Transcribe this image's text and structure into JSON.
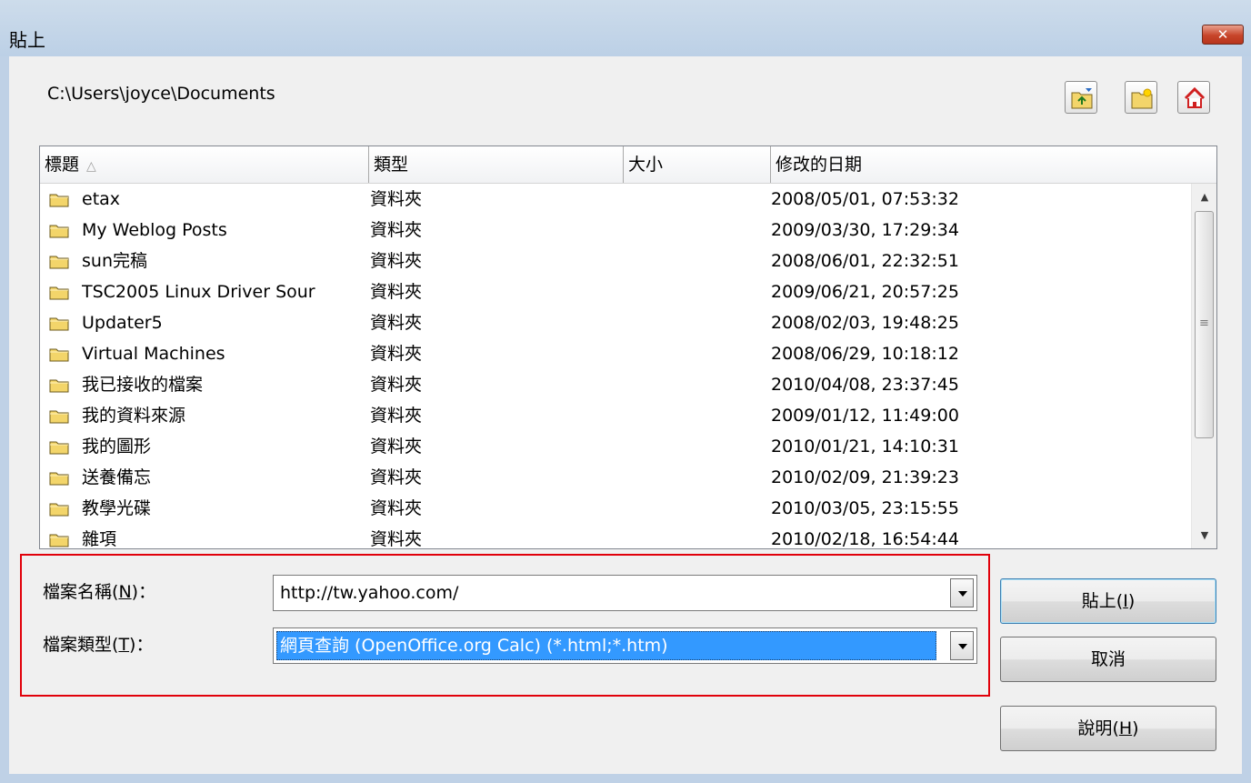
{
  "window": {
    "title": "貼上",
    "close_glyph": "✕"
  },
  "path": "C:\\Users\\joyce\\Documents",
  "toolbar": {
    "icons": [
      "folder-up-icon",
      "new-folder-icon",
      "home-icon"
    ]
  },
  "columns": [
    "標題",
    "類型",
    "大小",
    "修改的日期"
  ],
  "sort_indicator": "△",
  "files": [
    {
      "name": "etax",
      "type": "資料夾",
      "size": "",
      "date": "2008/05/01, 07:53:32"
    },
    {
      "name": "My Weblog Posts",
      "type": "資料夾",
      "size": "",
      "date": "2009/03/30, 17:29:34"
    },
    {
      "name": "sun完稿",
      "type": "資料夾",
      "size": "",
      "date": "2008/06/01, 22:32:51"
    },
    {
      "name": "TSC2005 Linux Driver Sour",
      "type": "資料夾",
      "size": "",
      "date": "2009/06/21, 20:57:25"
    },
    {
      "name": "Updater5",
      "type": "資料夾",
      "size": "",
      "date": "2008/02/03, 19:48:25"
    },
    {
      "name": "Virtual Machines",
      "type": "資料夾",
      "size": "",
      "date": "2008/06/29, 10:18:12"
    },
    {
      "name": "我已接收的檔案",
      "type": "資料夾",
      "size": "",
      "date": "2010/04/08, 23:37:45"
    },
    {
      "name": "我的資料來源",
      "type": "資料夾",
      "size": "",
      "date": "2009/01/12, 11:49:00"
    },
    {
      "name": "我的圖形",
      "type": "資料夾",
      "size": "",
      "date": "2010/01/21, 14:10:31"
    },
    {
      "name": "送養備忘",
      "type": "資料夾",
      "size": "",
      "date": "2010/02/09, 21:39:23"
    },
    {
      "name": "教學光碟",
      "type": "資料夾",
      "size": "",
      "date": "2010/03/05, 23:15:55"
    },
    {
      "name": "雜項",
      "type": "資料夾",
      "size": "",
      "date": "2010/02/18, 16:54:44"
    }
  ],
  "filename": {
    "label": "檔案名稱",
    "accel": "N",
    "value": "http://tw.yahoo.com/"
  },
  "filetype": {
    "label": "檔案類型",
    "accel": "T",
    "value": "網頁查詢 (OpenOffice.org Calc) (*.html;*.htm)"
  },
  "buttons": {
    "paste": {
      "label": "貼上",
      "accel": "I"
    },
    "cancel": {
      "label": "取消"
    },
    "help": {
      "label": "說明",
      "accel": "H"
    }
  },
  "colors": {
    "highlight_border": "#e1000a",
    "selection": "#3399ff",
    "folder": "#f3d56a"
  }
}
